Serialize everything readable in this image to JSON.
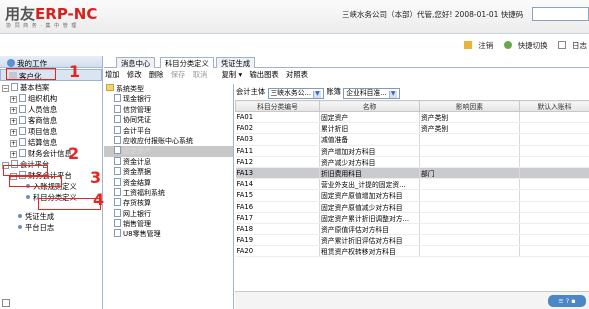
{
  "header": {
    "logo_main": "用友",
    "logo_brand": "ERP-NC",
    "logo_sub": "协 同 商 务  · 集 中 管 理",
    "info": "三峡水务公司（本部）代管,您好! 2008-01-01",
    "quick_label": "快捷码"
  },
  "topbar": {
    "logout": "注销",
    "quick_switch": "快捷切换",
    "log": "日志"
  },
  "sidebar": {
    "title": "我的工作",
    "selected": "客户化",
    "items": [
      "基本档案",
      "组织机构",
      "人员信息",
      "客商信息",
      "项目信息",
      "结算信息",
      "财务会计信息"
    ],
    "platform": "会计平台",
    "platform_child": "财务会计平台",
    "platform_children": [
      "入账规则定义",
      "科目分类定义"
    ],
    "others": [
      "凭证生成",
      "平台日志"
    ]
  },
  "annotations": [
    "1",
    "2",
    "3",
    "4"
  ],
  "tabs": [
    "消息中心",
    "科目分类定义",
    "凭证生成"
  ],
  "toolbar": {
    "add": "增加",
    "edit": "修改",
    "delete": "删除",
    "save": "保存",
    "cancel": "取消",
    "copy": "复制 ▾",
    "print": "输出图表",
    "compare": "对照表"
  },
  "typelist": {
    "root": "系统类型",
    "items": [
      "现金银行",
      "信贷管理",
      "协同凭证",
      "会计平台",
      "应收应付报账中心系统",
      "固定资产",
      "资金计息",
      "资金票据",
      "资金结算",
      "工资福利系统",
      "存货核算",
      "网上银行",
      "销售管理",
      "U8零售管理"
    ],
    "highlight_index": 5
  },
  "filter": {
    "entity_label": "会计主体",
    "entity_value": "三峡水务公...",
    "book_label": "账簿",
    "book_value": "企业科目准..."
  },
  "table": {
    "columns": [
      "科目分类编号",
      "名称",
      "影响因素",
      "默认入账科"
    ],
    "rows": [
      [
        "FA01",
        "固定资产",
        "资产类别",
        ""
      ],
      [
        "FA02",
        "累计折旧",
        "资产类别",
        ""
      ],
      [
        "FA03",
        "减值准备",
        "",
        ""
      ],
      [
        "FA11",
        "资产增加对方科目",
        "",
        ""
      ],
      [
        "FA12",
        "资产减少对方科目",
        "",
        ""
      ],
      [
        "FA13",
        "折旧费用科目",
        "部门",
        ""
      ],
      [
        "FA14",
        "营业外支出_计提的固定资...",
        "",
        ""
      ],
      [
        "FA15",
        "固定资产原值增加对方科目",
        "",
        ""
      ],
      [
        "FA16",
        "固定资产原值减少对方科目",
        "",
        ""
      ],
      [
        "FA17",
        "固定资产累计折旧调整对方...",
        "",
        ""
      ],
      [
        "FA18",
        "资产原值评估对方科目",
        "",
        ""
      ],
      [
        "FA19",
        "资产累计折旧评估对方科目",
        "",
        ""
      ],
      [
        "FA20",
        "租赁资产权转移对方科目",
        "",
        ""
      ]
    ],
    "selected_index": 5
  },
  "status": {
    "label": "≡ ? ▪"
  }
}
